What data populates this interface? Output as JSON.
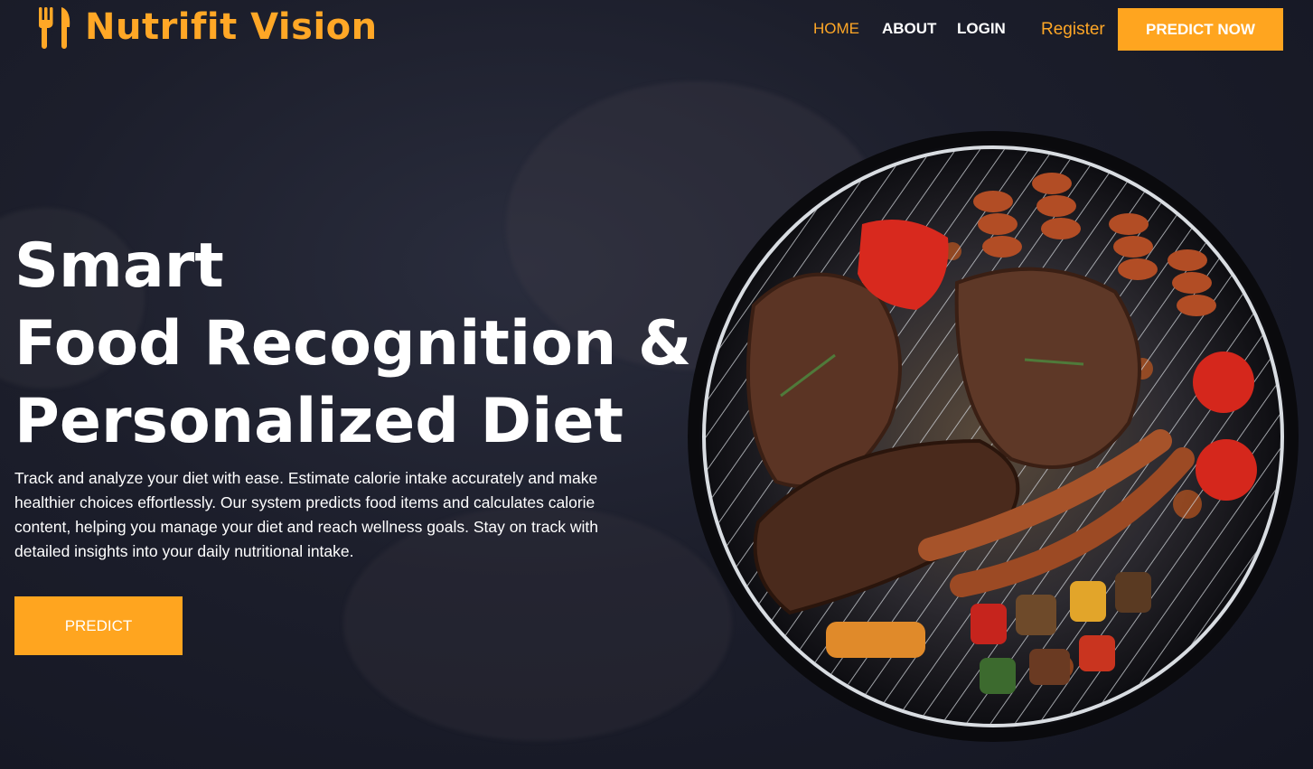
{
  "brand": {
    "name": "Nutrifit Vision",
    "icon": "fork-knife-icon"
  },
  "nav": {
    "items": [
      {
        "label": "HOME",
        "active": true
      },
      {
        "label": "ABOUT",
        "active": false
      },
      {
        "label": "LOGIN",
        "active": false
      }
    ],
    "register_label": "Register",
    "cta_label": "PREDICT NOW"
  },
  "hero": {
    "title_lines": [
      "Smart",
      "Food Recognition &",
      "Personalized Diet"
    ],
    "description": "Track and analyze your diet with ease. Estimate calorie intake accurately and make healthier choices effortlessly. Our system predicts food items and calculates calorie content, helping you manage your diet and reach wellness goals. Stay on track with detailed insights into your daily nutritional intake.",
    "button_label": "PREDICT",
    "image": "grill-with-meats-image"
  },
  "colors": {
    "accent": "#ffa51f",
    "background": "#1c1e2b",
    "text": "#ffffff"
  }
}
